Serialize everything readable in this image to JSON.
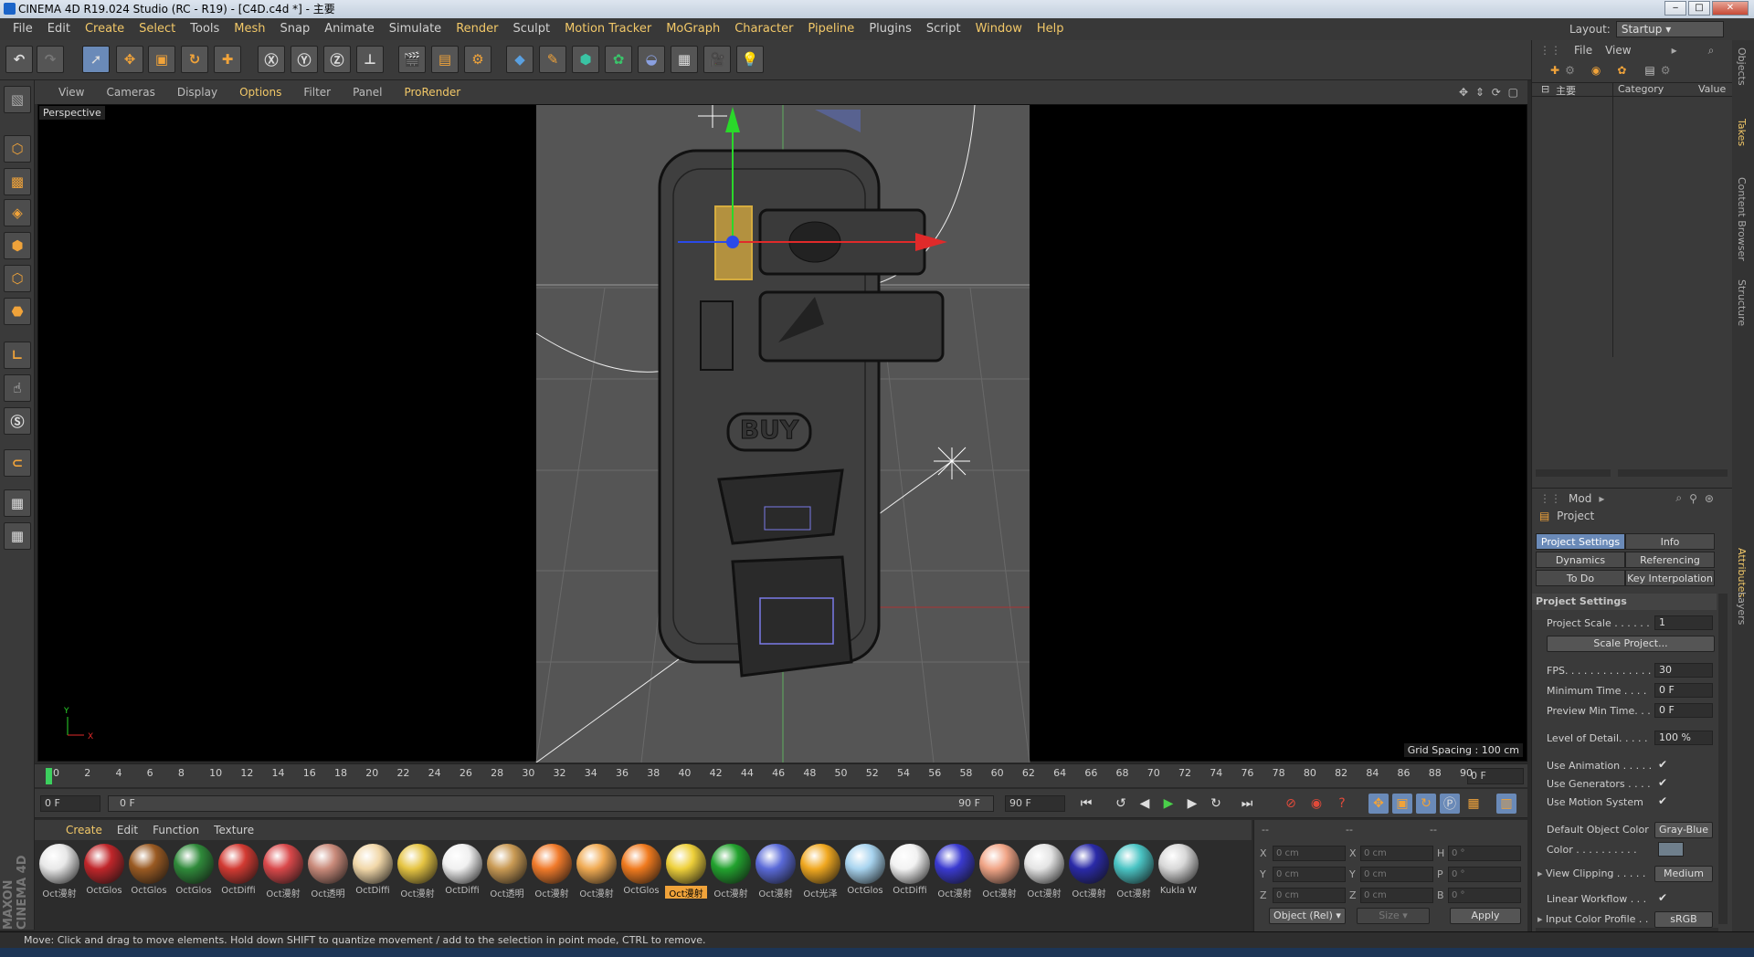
{
  "window": {
    "title": "CINEMA 4D R19.024 Studio (RC - R19) - [C4D.c4d *] - 主要"
  },
  "menubar": {
    "items": [
      "File",
      "Edit",
      "Create",
      "Select",
      "Tools",
      "Mesh",
      "Snap",
      "Animate",
      "Simulate",
      "Render",
      "Sculpt",
      "Motion Tracker",
      "MoGraph",
      "Character",
      "Pipeline",
      "Plugins",
      "Script",
      "Window",
      "Help"
    ]
  },
  "layout": {
    "label": "Layout:",
    "value": "Startup"
  },
  "viewport": {
    "menu": [
      "View",
      "Cameras",
      "Display",
      "Options",
      "Filter",
      "Panel",
      "ProRender"
    ],
    "camera": "Perspective",
    "grid_spacing": "Grid Spacing : 100 cm",
    "buy_label": "BUY",
    "axis_y": "Y",
    "axis_x": "X"
  },
  "timeline": {
    "ticks": [
      "0",
      "2",
      "4",
      "6",
      "8",
      "10",
      "12",
      "14",
      "16",
      "18",
      "20",
      "22",
      "24",
      "26",
      "28",
      "30",
      "32",
      "34",
      "36",
      "38",
      "40",
      "42",
      "44",
      "46",
      "48",
      "50",
      "52",
      "54",
      "56",
      "58",
      "60",
      "62",
      "64",
      "66",
      "68",
      "70",
      "72",
      "74",
      "76",
      "78",
      "80",
      "82",
      "84",
      "86",
      "88",
      "90"
    ],
    "current_frame": "0 F"
  },
  "transport": {
    "start": "0 F",
    "range_start": "0 F",
    "range_end": "90 F",
    "end": "90 F"
  },
  "materials": {
    "menu": [
      "Create",
      "Edit",
      "Function",
      "Texture"
    ],
    "items": [
      {
        "label": "Oct漫射",
        "color": "#e8e8e8"
      },
      {
        "label": "OctGlos",
        "color": "#c0262a"
      },
      {
        "label": "OctGlos",
        "color": "#9a5a22"
      },
      {
        "label": "OctGlos",
        "color": "#2f8a3a"
      },
      {
        "label": "OctDiffi",
        "color": "#d23a32"
      },
      {
        "label": "Oct漫射",
        "color": "#d9484a"
      },
      {
        "label": "Oct透明",
        "color": "#c98a7a"
      },
      {
        "label": "OctDiffi",
        "color": "#f1d7a8"
      },
      {
        "label": "Oct漫射",
        "color": "#e5c442"
      },
      {
        "label": "OctDiffi",
        "color": "#f0f0f0"
      },
      {
        "label": "Oct透明",
        "color": "#c99a54"
      },
      {
        "label": "Oct漫射",
        "color": "#f07a2a"
      },
      {
        "label": "Oct漫射",
        "color": "#f0aa52"
      },
      {
        "label": "OctGlos",
        "color": "#f07a1e"
      },
      {
        "label": "Oct漫射",
        "color": "#eed03a"
      },
      {
        "label": "Oct漫射",
        "color": "#22a22e"
      },
      {
        "label": "Oct漫射",
        "color": "#5a6ad8"
      },
      {
        "label": "Oct光泽",
        "color": "#f0a820"
      },
      {
        "label": "OctGlos",
        "color": "#a8d4ef"
      },
      {
        "label": "OctDiffi",
        "color": "#f2f2f2"
      },
      {
        "label": "Oct漫射",
        "color": "#3a3ad0"
      },
      {
        "label": "Oct漫射",
        "color": "#f0a486"
      },
      {
        "label": "Oct漫射",
        "color": "#e4e4e4"
      },
      {
        "label": "Oct漫射",
        "color": "#2a2aa8"
      },
      {
        "label": "Oct漫射",
        "color": "#4ac4c4"
      },
      {
        "label": "Kukla W",
        "color": "#d8d8d8"
      }
    ],
    "selected_index": 14
  },
  "coords": {
    "headers": [
      "--",
      "--",
      "--"
    ],
    "rows": [
      {
        "a": "X",
        "av": "0 cm",
        "b": "X",
        "bv": "0 cm",
        "c": "H",
        "cv": "0 °"
      },
      {
        "a": "Y",
        "av": "0 cm",
        "b": "Y",
        "bv": "0 cm",
        "c": "P",
        "cv": "0 °"
      },
      {
        "a": "Z",
        "av": "0 cm",
        "b": "Z",
        "bv": "0 cm",
        "c": "B",
        "cv": "0 °"
      }
    ],
    "mode": "Object (Rel)",
    "size": "Size",
    "apply": "Apply"
  },
  "objects": {
    "menu": [
      "File",
      "View"
    ],
    "root": "主要",
    "col_category": "Category",
    "col_value": "Value"
  },
  "attributes": {
    "menu": "Mod",
    "object": "Project",
    "tabs": [
      "Project Settings",
      "Info",
      "Dynamics",
      "Referencing",
      "To Do",
      "Key Interpolation"
    ],
    "section": "Project Settings",
    "rows": [
      {
        "label": "Project Scale . . . . . .",
        "value": "1"
      },
      {
        "label": "FPS. . . . . . . . . . . . . .",
        "value": "30"
      },
      {
        "label": "Minimum Time . . . .",
        "value": "0 F"
      },
      {
        "label": "Preview Min Time. . .",
        "value": "0 F"
      },
      {
        "label": "Level of Detail. . . . .",
        "value": "100 %"
      }
    ],
    "scale_button": "Scale Project...",
    "checks": [
      {
        "label": "Use Animation . . . . .",
        "value": "✔"
      },
      {
        "label": "Use Generators . . . .",
        "value": "✔"
      },
      {
        "label": "Use Motion System",
        "value": "✔"
      }
    ],
    "default_color_label": "Default Object Color",
    "default_color_value": "Gray-Blue",
    "color_label": "Color . . . . . . . . . .",
    "view_clipping_label": "View Clipping . . . . .",
    "view_clipping_value": "Medium",
    "linear_label": "Linear Workflow . . .",
    "linear_value": "✔",
    "input_profile_label": "Input Color Profile . .",
    "input_profile_value": "sRGB"
  },
  "sidetabs": [
    "Objects",
    "Takes",
    "Content Browser",
    "Structure",
    "Attributes",
    "Layers"
  ],
  "status": "Move: Click and drag to move elements. Hold down SHIFT to quantize movement / add to the selection in point mode, CTRL to remove.",
  "brand": "MAXON CINEMA 4D"
}
